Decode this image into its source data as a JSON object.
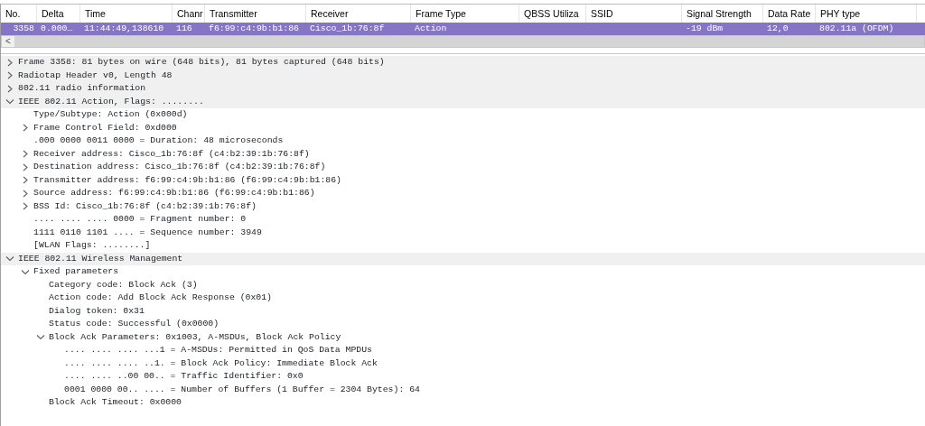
{
  "packet_list": {
    "columns": [
      "No.",
      "Delta",
      "Time",
      "Chanr",
      "Transmitter",
      "Receiver",
      "Frame Type",
      "QBSS Utiliza",
      "SSID",
      "Signal Strength",
      "Data Rate",
      "PHY type"
    ],
    "rows": [
      {
        "selected": true,
        "cells": [
          "3358",
          "0.000…",
          "11:44:49,138610",
          "116",
          "f6:99:c4:9b:b1:86",
          "Cisco_1b:76:8f",
          "Action",
          "",
          "",
          "-19 dBm",
          "12,0",
          "802.11a (OFDM)"
        ]
      }
    ],
    "scroll_left": "<"
  },
  "details": [
    {
      "text": "Frame 3358: 81 bytes on wire (648 bits), 81 bytes captured (648 bits)",
      "expanded": false
    },
    {
      "text": "Radiotap Header v0, Length 48",
      "expanded": false
    },
    {
      "text": "802.11 radio information",
      "expanded": false
    },
    {
      "text": "IEEE 802.11 Action, Flags: ........",
      "expanded": true,
      "children": [
        {
          "text": "Type/Subtype: Action (0x000d)"
        },
        {
          "text": "Frame Control Field: 0xd000",
          "expanded": false
        },
        {
          "text": ".000 0000 0011 0000 = Duration: 48 microseconds"
        },
        {
          "text": "Receiver address: Cisco_1b:76:8f (c4:b2:39:1b:76:8f)",
          "expanded": false
        },
        {
          "text": "Destination address: Cisco_1b:76:8f (c4:b2:39:1b:76:8f)",
          "expanded": false
        },
        {
          "text": "Transmitter address: f6:99:c4:9b:b1:86 (f6:99:c4:9b:b1:86)",
          "expanded": false
        },
        {
          "text": "Source address: f6:99:c4:9b:b1:86 (f6:99:c4:9b:b1:86)",
          "expanded": false
        },
        {
          "text": "BSS Id: Cisco_1b:76:8f (c4:b2:39:1b:76:8f)",
          "expanded": false
        },
        {
          "text": ".... .... .... 0000 = Fragment number: 0"
        },
        {
          "text": "1111 0110 1101 .... = Sequence number: 3949"
        },
        {
          "text": "[WLAN Flags: ........]"
        }
      ]
    },
    {
      "text": "IEEE 802.11 Wireless Management",
      "expanded": true,
      "children": [
        {
          "text": "Fixed parameters",
          "expanded": true,
          "children": [
            {
              "text": "Category code: Block Ack (3)"
            },
            {
              "text": "Action code: Add Block Ack Response (0x01)"
            },
            {
              "text": "Dialog token: 0x31"
            },
            {
              "text": "Status code: Successful (0x0000)"
            },
            {
              "text": "Block Ack Parameters: 0x1003, A-MSDUs, Block Ack Policy",
              "expanded": true,
              "children": [
                {
                  "text": ".... .... .... ...1 = A-MSDUs: Permitted in QoS Data MPDUs"
                },
                {
                  "text": ".... .... .... ..1. = Block Ack Policy: Immediate Block Ack"
                },
                {
                  "text": ".... .... ..00 00.. = Traffic Identifier: 0x0"
                },
                {
                  "text": "0001 0000 00.. .... = Number of Buffers (1 Buffer = 2304 Bytes): 64"
                }
              ]
            },
            {
              "text": "Block Ack Timeout: 0x0000"
            }
          ]
        }
      ]
    }
  ]
}
